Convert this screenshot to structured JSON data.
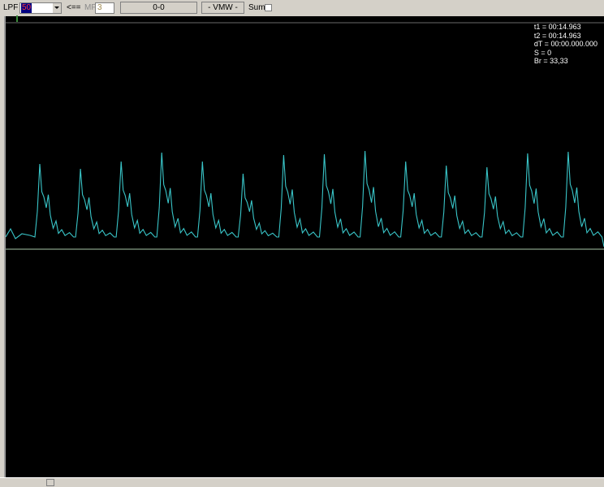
{
  "toolbar": {
    "lpf_label": "LPF",
    "lpf_value": "50",
    "arrow_label": "<==",
    "mf_label": "MF",
    "mf_value": "3",
    "range_button": "0-0",
    "vmw_button": "- VMW -",
    "sum_label": "Sum"
  },
  "readout": {
    "t1": "t1 = 00:14.963",
    "t2": "t2 = 00:14.963",
    "dt": "dT = 00:00.000.000",
    "s": "S = 0",
    "br": "Br = 33,33"
  },
  "colors": {
    "trace": "#39c5c8",
    "baseline": "#a8c8a8",
    "background": "#000000"
  },
  "waveform": {
    "beat_peaks": [
      202,
      208,
      199,
      188,
      199,
      214,
      191,
      190,
      186,
      199,
      204,
      206,
      189,
      187
    ],
    "beat_count": 14
  }
}
